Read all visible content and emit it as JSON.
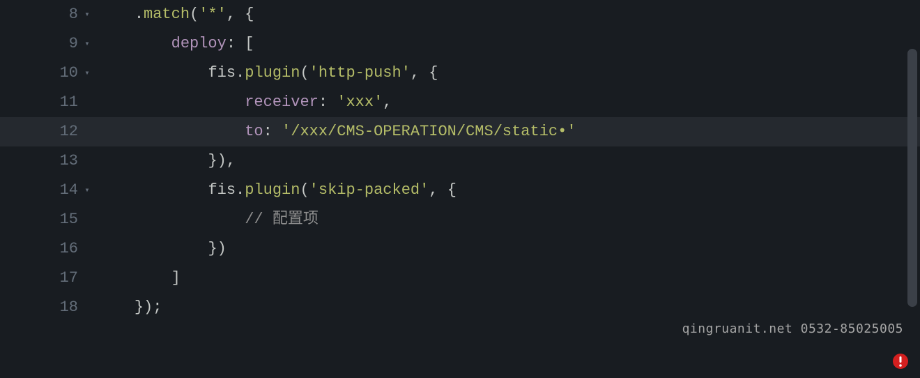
{
  "watermark": "qingruanit.net 0532-85025005",
  "gutter": {
    "8": {
      "num": "8",
      "fold": "▾"
    },
    "9": {
      "num": "9",
      "fold": "▾"
    },
    "10": {
      "num": "10",
      "fold": "▾"
    },
    "11": {
      "num": "11",
      "fold": ""
    },
    "12": {
      "num": "12",
      "fold": ""
    },
    "13": {
      "num": "13",
      "fold": ""
    },
    "14": {
      "num": "14",
      "fold": "▾"
    },
    "15": {
      "num": "15",
      "fold": ""
    },
    "16": {
      "num": "16",
      "fold": ""
    },
    "17": {
      "num": "17",
      "fold": ""
    },
    "18": {
      "num": "18",
      "fold": ""
    }
  },
  "code": {
    "l8": {
      "indent": "    ",
      "p1": ".",
      "m": "match",
      "p2": "(",
      "s": "'*'",
      "p3": ", {"
    },
    "l9": {
      "indent": "        ",
      "k": "deploy",
      "p": ": ["
    },
    "l10": {
      "indent": "            ",
      "ident": "fis",
      "dot": ".",
      "m": "plugin",
      "p1": "(",
      "s": "'http-push'",
      "p2": ", {"
    },
    "l11": {
      "indent": "                ",
      "k": "receiver",
      "p1": ": ",
      "s": "'xxx'",
      "p2": ","
    },
    "l12": {
      "indent": "                ",
      "k": "to",
      "p1": ": ",
      "s": "'/xxx/CMS-OPERATION/CMS/static•'"
    },
    "l13": {
      "indent": "            ",
      "p": "}),"
    },
    "l14": {
      "indent": "            ",
      "ident": "fis",
      "dot": ".",
      "m": "plugin",
      "p1": "(",
      "s": "'skip-packed'",
      "p2": ", {"
    },
    "l15": {
      "indent": "                ",
      "c": "// 配置项"
    },
    "l16": {
      "indent": "            ",
      "p": "})"
    },
    "l17": {
      "indent": "        ",
      "p": "]"
    },
    "l18": {
      "indent": "    ",
      "p": "});"
    }
  },
  "icons": {
    "error": "error-icon"
  }
}
